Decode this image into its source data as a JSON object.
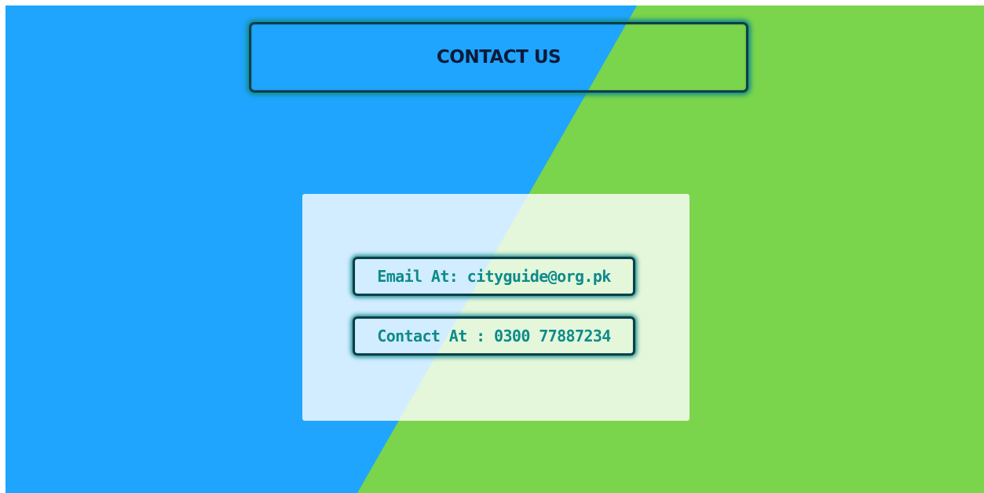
{
  "header": {
    "title": "CONTACT US"
  },
  "contact": {
    "email_label": "Email At: cityguide@org.pk",
    "phone_label": "Contact At : 0300 77887234"
  },
  "colors": {
    "left_background": "#1fa5fd",
    "right_background": "#7ad44c",
    "border": "#0b3f48",
    "glow": "#138a8e",
    "title_text": "#0e1a3a",
    "info_text": "#0f8a8a"
  }
}
